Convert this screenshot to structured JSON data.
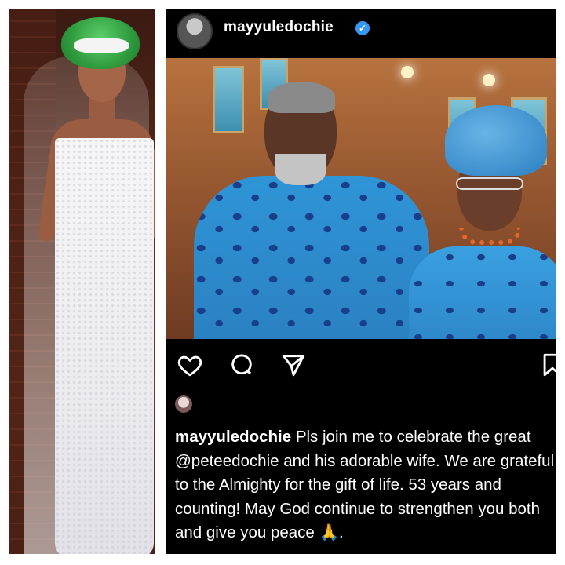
{
  "post": {
    "username": "mayyuledochie",
    "caption_user": "mayyuledochie",
    "caption_text": "Pls join me to celebrate the great @peteedochie and his adorable wife. We are grateful to the Almighty for the gift of life. 53 years and counting! May God continue to strengthen you both and give you peace 🙏.",
    "verified_badge": "✓"
  },
  "icons": {
    "like": "heart-icon",
    "comment": "comment-icon",
    "share": "send-icon",
    "save": "bookmark-icon"
  },
  "colors": {
    "background": "#000000",
    "text": "#ffffff",
    "verified": "#3897f0"
  }
}
